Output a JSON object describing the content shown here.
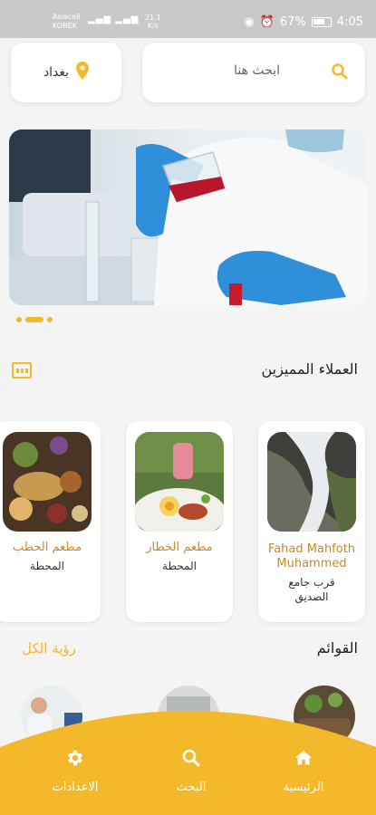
{
  "status_bar": {
    "carrier_top": "Asiacell",
    "carrier_bottom": "KOREK",
    "speed_value": "21.1",
    "speed_unit": "K/s",
    "battery": "67%",
    "time": "4:05"
  },
  "header": {
    "location": "بغداد",
    "search_placeholder": "ابحث هنا"
  },
  "featured": {
    "title": "العملاء المميزين",
    "restaurants": [
      {
        "name": "مطعم الحطب",
        "address": "المحطة"
      },
      {
        "name": "مطعم الخطار",
        "address": "المحطة"
      },
      {
        "name": "Fahad Mahfoth Muhammed",
        "address": "قرب جامع الصديق"
      }
    ]
  },
  "lists": {
    "title": "القوائم",
    "see_all": "رؤية الكل"
  },
  "bottom_nav": {
    "settings": "الاعدادات",
    "search": "البحث",
    "home": "الرئيسية"
  },
  "colors": {
    "accent": "#f4b92a",
    "name_text": "#c8882b"
  }
}
